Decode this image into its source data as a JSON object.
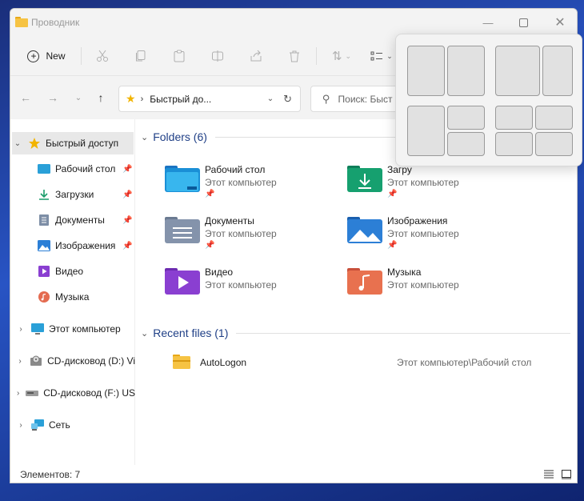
{
  "window": {
    "title": "Проводник"
  },
  "toolbar": {
    "new_label": "New"
  },
  "address": {
    "path": "Быстрый до...",
    "search_placeholder": "Поиск: Быст"
  },
  "sidebar": {
    "items": [
      {
        "label": "Быстрый доступ",
        "icon": "star-icon"
      },
      {
        "label": "Рабочий стол",
        "icon": "desktop-icon"
      },
      {
        "label": "Загрузки",
        "icon": "download-icon"
      },
      {
        "label": "Документы",
        "icon": "documents-icon"
      },
      {
        "label": "Изображения",
        "icon": "pictures-icon"
      },
      {
        "label": "Видео",
        "icon": "video-icon"
      },
      {
        "label": "Музыка",
        "icon": "music-icon"
      },
      {
        "label": "Этот компьютер",
        "icon": "computer-icon"
      },
      {
        "label": "CD-дисковод (D:) Vi",
        "icon": "cd-drive-icon"
      },
      {
        "label": "CD-дисковод (F:) US",
        "icon": "drive-icon"
      },
      {
        "label": "Сеть",
        "icon": "network-icon"
      }
    ]
  },
  "folders": {
    "header": "Folders (6)",
    "items": [
      {
        "name": "Рабочий стол",
        "location": "Этот компьютер",
        "icon": "desktop-folder-icon"
      },
      {
        "name": "Загру",
        "location": "Этот компьютер",
        "icon": "downloads-folder-icon"
      },
      {
        "name": "Документы",
        "location": "Этот компьютер",
        "icon": "documents-folder-icon"
      },
      {
        "name": "Изображения",
        "location": "Этот компьютер",
        "icon": "pictures-folder-icon"
      },
      {
        "name": "Видео",
        "location": "Этот компьютер",
        "icon": "video-folder-icon"
      },
      {
        "name": "Музыка",
        "location": "Этот компьютер",
        "icon": "music-folder-icon"
      }
    ]
  },
  "recent": {
    "header": "Recent files (1)",
    "items": [
      {
        "name": "AutoLogon",
        "path": "Этот компьютер\\Рабочий стол",
        "icon": "folder-zip-icon"
      }
    ]
  },
  "status": {
    "count": "Элементов: 7"
  },
  "colors": {
    "accent": "#1f3f86",
    "selection": "#e8e8e8",
    "star": "#f2b400"
  }
}
